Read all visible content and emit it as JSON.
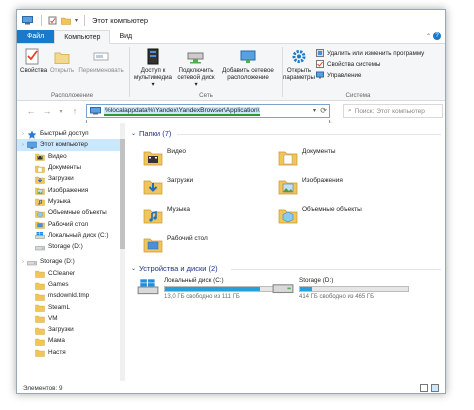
{
  "window": {
    "title": "Этот компьютер",
    "qat_items": [
      "properties-icon",
      "new-folder-icon",
      "customize-qat-icon"
    ]
  },
  "tabs": [
    {
      "label": "Файл"
    },
    {
      "label": "Компьютер"
    },
    {
      "label": "Вид"
    }
  ],
  "ribbon": {
    "location_group": {
      "label": "Расположение",
      "buttons": [
        "Свойства",
        "Открыть",
        "Переименовать"
      ]
    },
    "network_group": {
      "label": "Сеть",
      "buttons": [
        "Доступ к мультимедиа ▾",
        "Подключить сетевой диск ▾",
        "Добавить сетевое расположение"
      ]
    },
    "system_group": {
      "label": "Система",
      "open_settings": "Открыть параметры",
      "small_buttons": [
        "Удалить или изменить программу",
        "Свойства системы",
        "Управление"
      ]
    },
    "collapse_icon": "chevron-up-icon",
    "help_icon": "help-icon"
  },
  "address_bar": {
    "value": "%localappdata%\\Yandex\\YandexBrowser\\Application\\",
    "search_placeholder": "Поиск: Этот компьютер"
  },
  "nav_pane": {
    "items": [
      {
        "label": "Быстрый доступ",
        "icon": "star-icon",
        "level": 0
      },
      {
        "label": "Этот компьютер",
        "icon": "computer-icon",
        "level": 0,
        "selected": true
      },
      {
        "label": "Видео",
        "icon": "video-folder-icon",
        "level": 1
      },
      {
        "label": "Документы",
        "icon": "documents-folder-icon",
        "level": 1
      },
      {
        "label": "Загрузки",
        "icon": "downloads-folder-icon",
        "level": 1
      },
      {
        "label": "Изображения",
        "icon": "pictures-folder-icon",
        "level": 1
      },
      {
        "label": "Музыка",
        "icon": "music-folder-icon",
        "level": 1
      },
      {
        "label": "Объемные объекты",
        "icon": "3d-objects-folder-icon",
        "level": 1
      },
      {
        "label": "Рабочий стол",
        "icon": "desktop-folder-icon",
        "level": 1
      },
      {
        "label": "Локальный диск (C:)",
        "icon": "windows-drive-icon",
        "level": 1
      },
      {
        "label": "Storage (D:)",
        "icon": "drive-icon",
        "level": 1
      },
      {
        "label": "Storage (D:)",
        "icon": "drive-icon",
        "level": 0
      },
      {
        "label": "CCleaner",
        "icon": "folder-icon",
        "level": 1
      },
      {
        "label": "Games",
        "icon": "folder-icon",
        "level": 1
      },
      {
        "label": "msdownld.tmp",
        "icon": "folder-icon",
        "level": 1
      },
      {
        "label": "SteamL",
        "icon": "folder-icon",
        "level": 1
      },
      {
        "label": "VM",
        "icon": "folder-icon",
        "level": 1
      },
      {
        "label": "Загрузки",
        "icon": "folder-icon",
        "level": 1
      },
      {
        "label": "Мама",
        "icon": "folder-icon",
        "level": 1
      },
      {
        "label": "Настя",
        "icon": "folder-icon",
        "level": 1
      }
    ]
  },
  "content": {
    "folders_header": "Папки (7)",
    "folders": [
      {
        "label": "Видео",
        "icon": "video-folder-icon"
      },
      {
        "label": "Документы",
        "icon": "documents-folder-icon"
      },
      {
        "label": "Загрузки",
        "icon": "downloads-folder-icon"
      },
      {
        "label": "Изображения",
        "icon": "pictures-folder-icon"
      },
      {
        "label": "Музыка",
        "icon": "music-folder-icon"
      },
      {
        "label": "Объемные объекты",
        "icon": "3d-objects-folder-icon"
      },
      {
        "label": "Рабочий стол",
        "icon": "desktop-folder-icon"
      }
    ],
    "drives_header": "Устройства и диски (2)",
    "drives": [
      {
        "label": "Локальный диск (C:)",
        "free": "13,0 ГБ свободно из 111 ГБ",
        "used_fraction": 0.88,
        "icon": "windows-drive-icon"
      },
      {
        "label": "Storage (D:)",
        "free": "414 ГБ свободно из 465 ГБ",
        "used_fraction": 0.11,
        "icon": "drive-icon"
      }
    ]
  },
  "status_bar": {
    "items_text": "Элементов: 9"
  },
  "colors": {
    "accent": "#1979ca",
    "selection": "#cce8ff",
    "drive_bar": "#26a0da",
    "folder": "#f0c55a"
  }
}
